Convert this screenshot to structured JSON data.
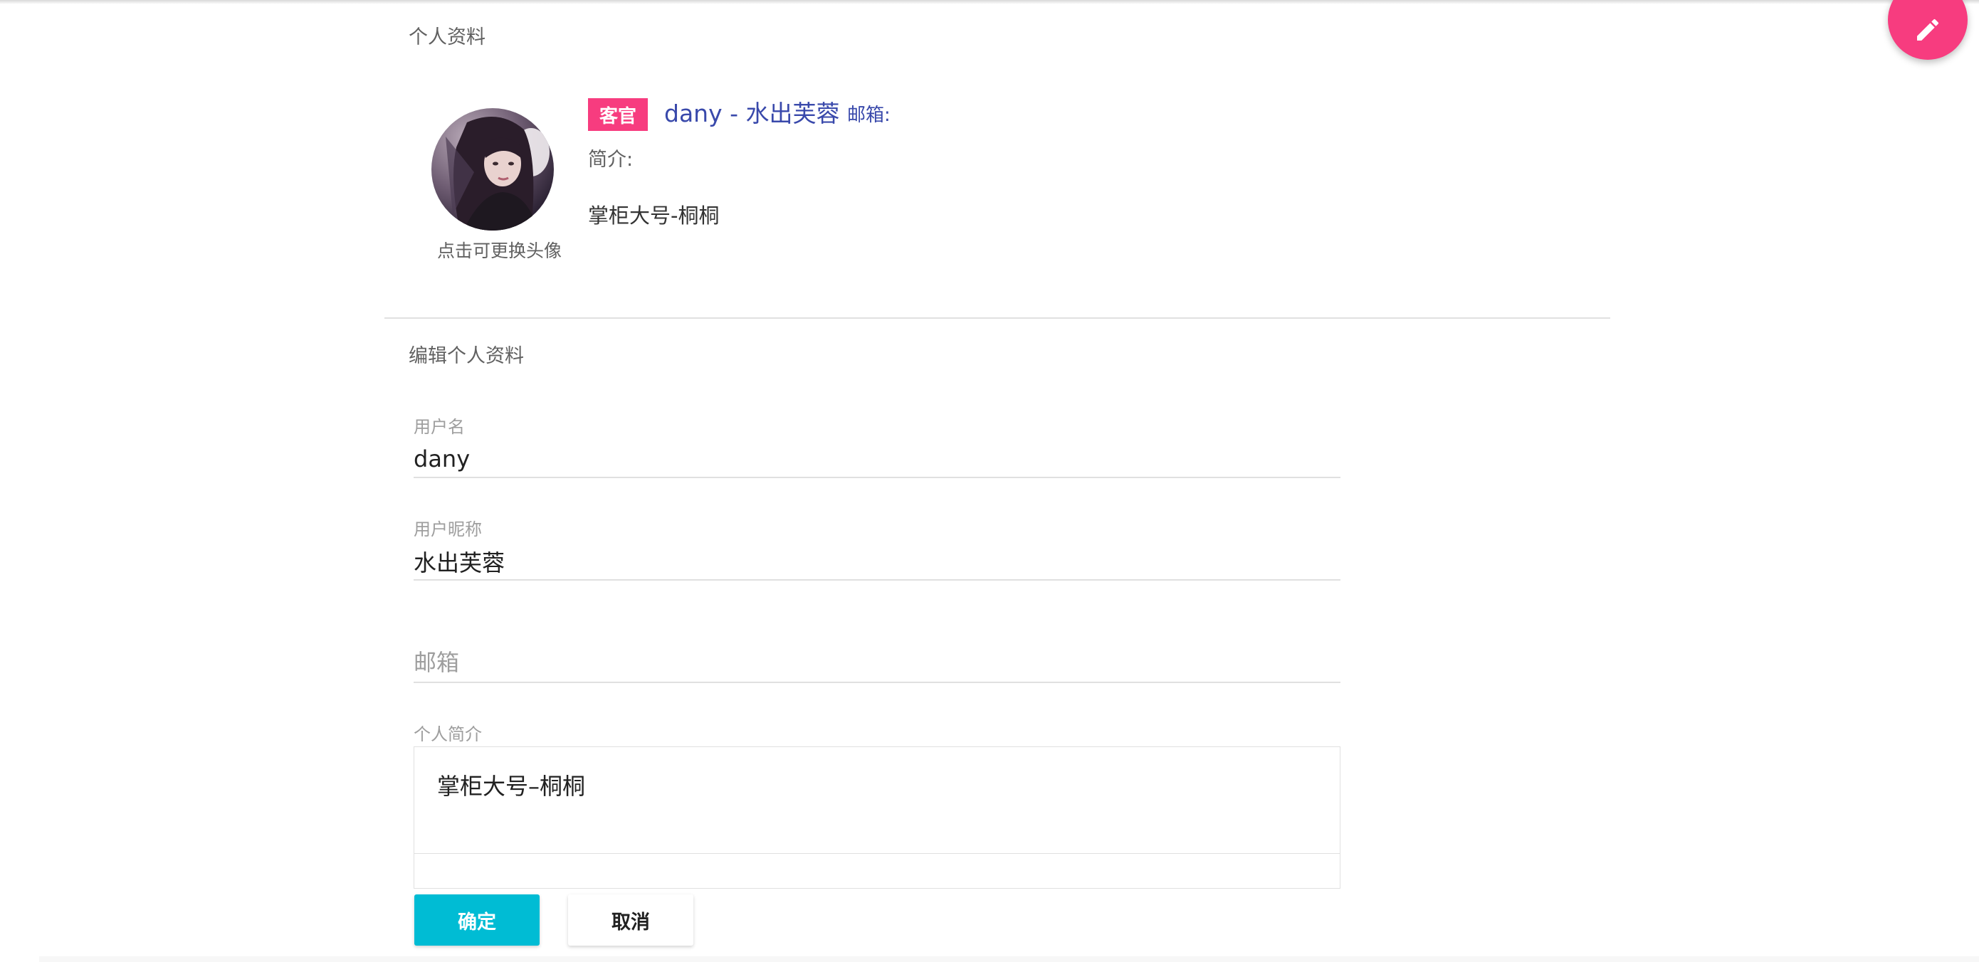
{
  "profile": {
    "section_title": "个人资料",
    "role_tag": "客官",
    "display_name": "dany - 水出芙蓉",
    "email_label": "邮箱:",
    "intro_label": "简介:",
    "intro_text": "掌柜大号-桐桐",
    "avatar_caption": "点击可更换头像"
  },
  "edit": {
    "section_title": "编辑个人资料",
    "username": {
      "label": "用户名",
      "value": "dany"
    },
    "nickname": {
      "label": "用户昵称",
      "value": "水出芙蓉"
    },
    "email": {
      "placeholder": "邮箱",
      "value": ""
    },
    "bio": {
      "label": "个人简介",
      "value": "掌柜大号–桐桐"
    },
    "confirm_label": "确定",
    "cancel_label": "取消"
  },
  "colors": {
    "accent_pink": "#f73c7f",
    "primary_blue": "#3949ab",
    "confirm_cyan": "#00bcd4"
  },
  "icons": {
    "fab": "pencil-edit-icon"
  }
}
